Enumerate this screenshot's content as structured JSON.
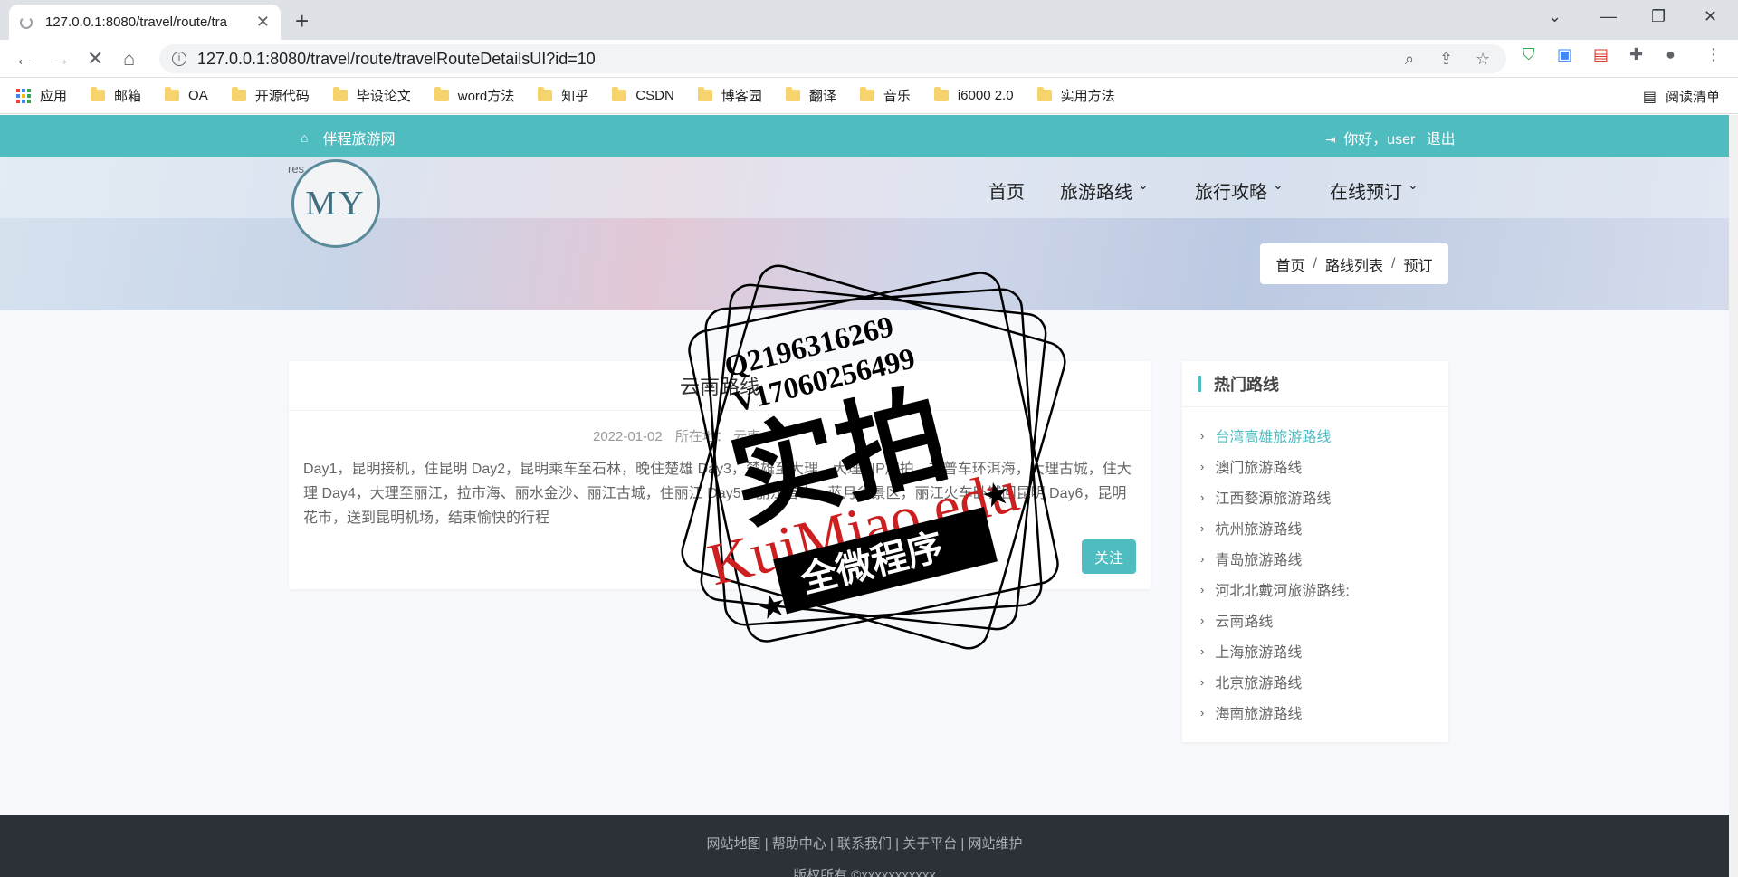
{
  "browser": {
    "tab_title": "127.0.0.1:8080/travel/route/tra",
    "url": "127.0.0.1:8080/travel/route/travelRouteDetailsUI?id=10",
    "bookmarks": [
      "应用",
      "邮箱",
      "OA",
      "开源代码",
      "毕设论文",
      "word方法",
      "知乎",
      "CSDN",
      "博客园",
      "翻译",
      "音乐",
      "i6000 2.0",
      "实用方法"
    ],
    "reading_list": "阅读清单"
  },
  "site": {
    "brand": "伴程旅游网",
    "user_greeting": "你好，user",
    "logout": "退出",
    "logo_text": "MY",
    "logo_alt": "res",
    "nav": [
      "首页",
      "旅游路线",
      "旅行攻略",
      "在线预订"
    ],
    "breadcrumb": [
      "首页",
      "路线列表",
      "预订"
    ]
  },
  "route": {
    "title": "云南路线",
    "date": "2022-01-02",
    "location_label": "所在地：",
    "location": "云南",
    "description": "Day1，昆明接机，住昆明 Day2，昆明乘车至石林，晚住楚雄 Day3，楚雄至大理，大理VIP旅拍，吉普车环洱海，大理古城，住大理 Day4，大理至丽江，拉市海、丽水金沙、丽江古城，住丽江 Day5，丽江雪山，蓝月谷景区，丽江火车卧铺回昆明 Day6，昆明花市，送到昆明机场，结束愉快的行程",
    "follow_label": "关注"
  },
  "sidebar": {
    "title": "热门路线",
    "items": [
      "台湾高雄旅游路线",
      "澳门旅游路线",
      "江西婺源旅游路线",
      "杭州旅游路线",
      "青岛旅游路线",
      "河北北戴河旅游路线:",
      "云南路线",
      "上海旅游路线",
      "北京旅游路线",
      "海南旅游路线"
    ]
  },
  "footer": {
    "links": "网站地图 | 帮助中心 | 联系我们 | 关于平台 | 网站维护",
    "copyright": "版权所有 ©xxxxxxxxxxx"
  },
  "watermark": {
    "line1": "Q2196316269",
    "line2": "V17060256499",
    "big": "实拍",
    "red": "KuiMiao.edu",
    "banner": "全微程序"
  },
  "colors": {
    "accent": "#4fbcc0",
    "footer": "#2c3137",
    "stamp_red": "#cc1f1f"
  }
}
